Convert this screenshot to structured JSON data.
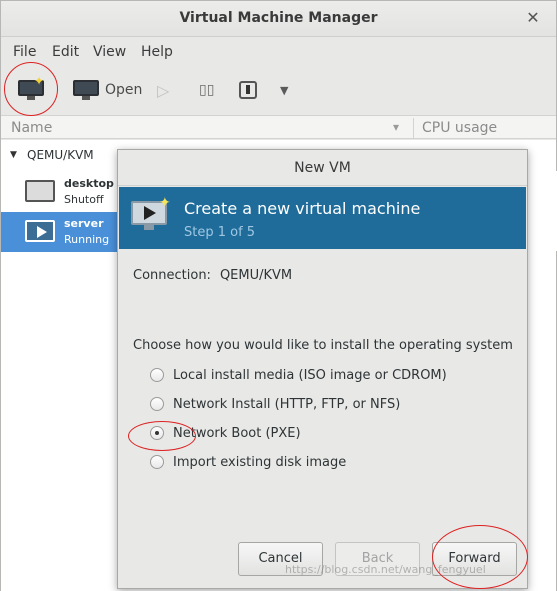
{
  "window": {
    "title": "Virtual Machine Manager"
  },
  "menu": [
    "File",
    "Edit",
    "View",
    "Help"
  ],
  "toolbar": {
    "open_label": "Open",
    "icons": [
      "new-vm-icon",
      "open-icon",
      "run-icon",
      "pause-icon",
      "shutdown-icon",
      "dropdown-icon"
    ]
  },
  "list": {
    "columns": [
      "Name",
      "CPU usage"
    ],
    "group": "QEMU/KVM",
    "vms": [
      {
        "name": "desktop",
        "status": "Shutoff"
      },
      {
        "name": "server",
        "status": "Running"
      }
    ]
  },
  "dialog": {
    "title": "New VM",
    "banner_title": "Create a new virtual machine",
    "banner_step": "Step 1 of 5",
    "connection_label": "Connection:",
    "connection_value": "QEMU/KVM",
    "question": "Choose how you would like to install the operating system",
    "options": [
      {
        "label": "Local install media (ISO image or CDROM)",
        "selected": false
      },
      {
        "label": "Network Install (HTTP, FTP, or NFS)",
        "selected": false
      },
      {
        "label": "Network Boot (PXE)",
        "selected": true
      },
      {
        "label": "Import existing disk image",
        "selected": false
      }
    ],
    "buttons": {
      "cancel": "Cancel",
      "back": "Back",
      "forward": "Forward"
    }
  },
  "watermark": "https://blog.csdn.net/wang_fengyuel",
  "colors": {
    "banner": "#1f6c9a",
    "selection": "#4a90d9",
    "annotation": "#dd2222"
  }
}
